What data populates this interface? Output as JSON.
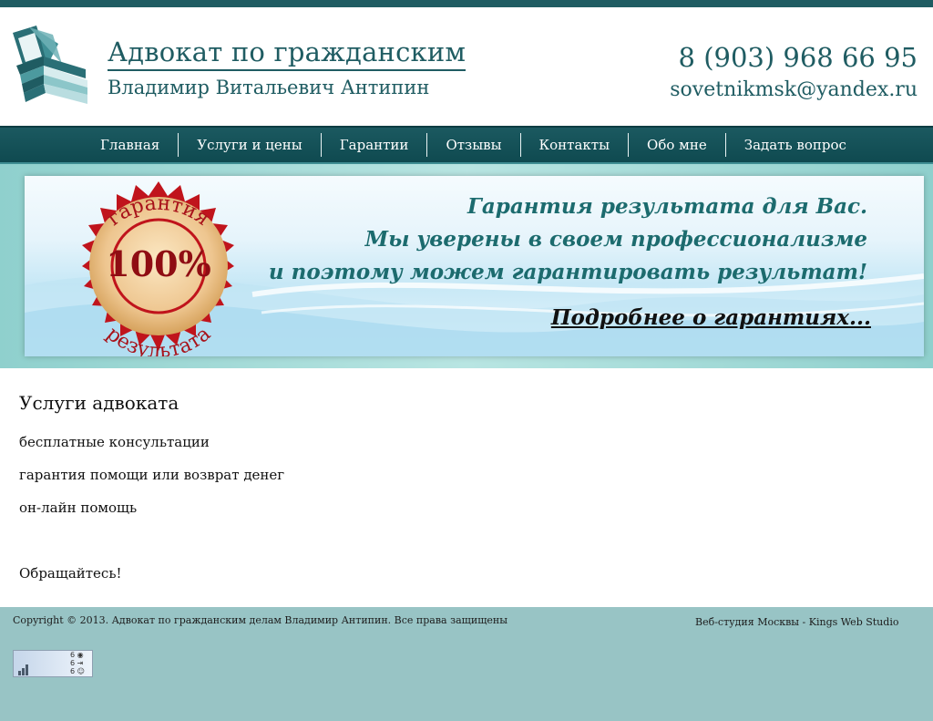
{
  "header": {
    "title": "Адвокат по гражданским",
    "subtitle": "Владимир Витальевич Антипин",
    "phone": "8 (903) 968 66 95",
    "email": "sovetnikmsk@yandex.ru",
    "logo_icon": "book-stack-icon"
  },
  "nav": {
    "items": [
      {
        "label": "Главная"
      },
      {
        "label": "Услуги и цены"
      },
      {
        "label": "Гарантии"
      },
      {
        "label": "Отзывы"
      },
      {
        "label": "Контакты"
      },
      {
        "label": "Обо мне"
      },
      {
        "label": "Задать вопрос"
      }
    ]
  },
  "banner": {
    "badge_top": "гарантия",
    "badge_percent": "100%",
    "badge_bottom": "результата",
    "line1": "Гарантия результата для Вас.",
    "line2": "Мы уверены в своем профессионализме",
    "line3": "и поэтому можем гарантировать результат!",
    "link": "Подробнее о гарантиях..."
  },
  "content": {
    "title": "Услуги адвоката",
    "items": [
      "бесплатные консультации",
      "гарантия помощи или возврат денег",
      "он-лайн помощь"
    ],
    "closing": "Обращайтесь!"
  },
  "footer": {
    "copyright": "Copyright © 2013. Адвокат по гражданским делам Владимир Антипин. Все права защищены",
    "studio": "Веб-студия Москвы - Kings Web Studio",
    "counter": {
      "views": "6",
      "visits": "6",
      "visitors": "6"
    }
  },
  "colors": {
    "brand": "#1f5c62",
    "nav_bg": "#135158",
    "footer_bg": "#98c4c5",
    "banner_text": "#1c6b6e",
    "badge_red": "#c0141c"
  }
}
